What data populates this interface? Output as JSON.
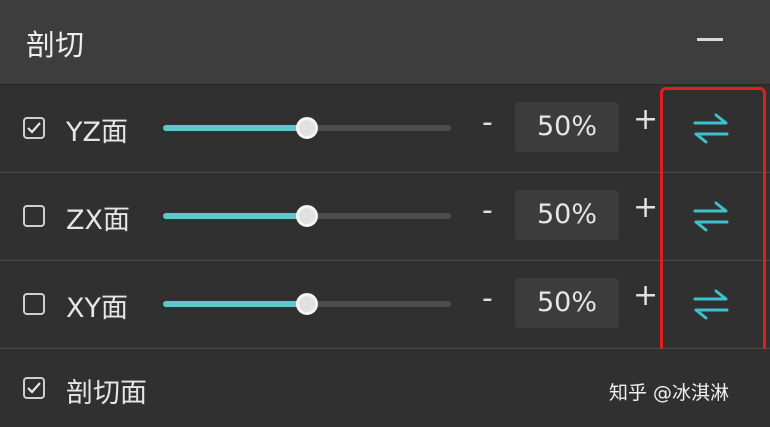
{
  "header": {
    "title": "剖切",
    "collapse_icon": "minus-icon"
  },
  "rows": [
    {
      "label": "YZ面",
      "checked": true,
      "slider_value_percent": 50,
      "value_text": "50%",
      "minus_label": "-",
      "plus_label": "+",
      "swap_icon": "swap-arrows-icon"
    },
    {
      "label": "ZX面",
      "checked": false,
      "slider_value_percent": 50,
      "value_text": "50%",
      "minus_label": "-",
      "plus_label": "+",
      "swap_icon": "swap-arrows-icon"
    },
    {
      "label": "XY面",
      "checked": false,
      "slider_value_percent": 50,
      "value_text": "50%",
      "minus_label": "-",
      "plus_label": "+",
      "swap_icon": "swap-arrows-icon"
    }
  ],
  "bottom": {
    "label": "剖切面",
    "checked": true
  },
  "watermark": "知乎 @冰淇淋",
  "colors": {
    "accent": "#5fc8cf",
    "highlight": "#e0201e",
    "panel_bg": "#303030",
    "header_bg": "#3d3d3d"
  }
}
